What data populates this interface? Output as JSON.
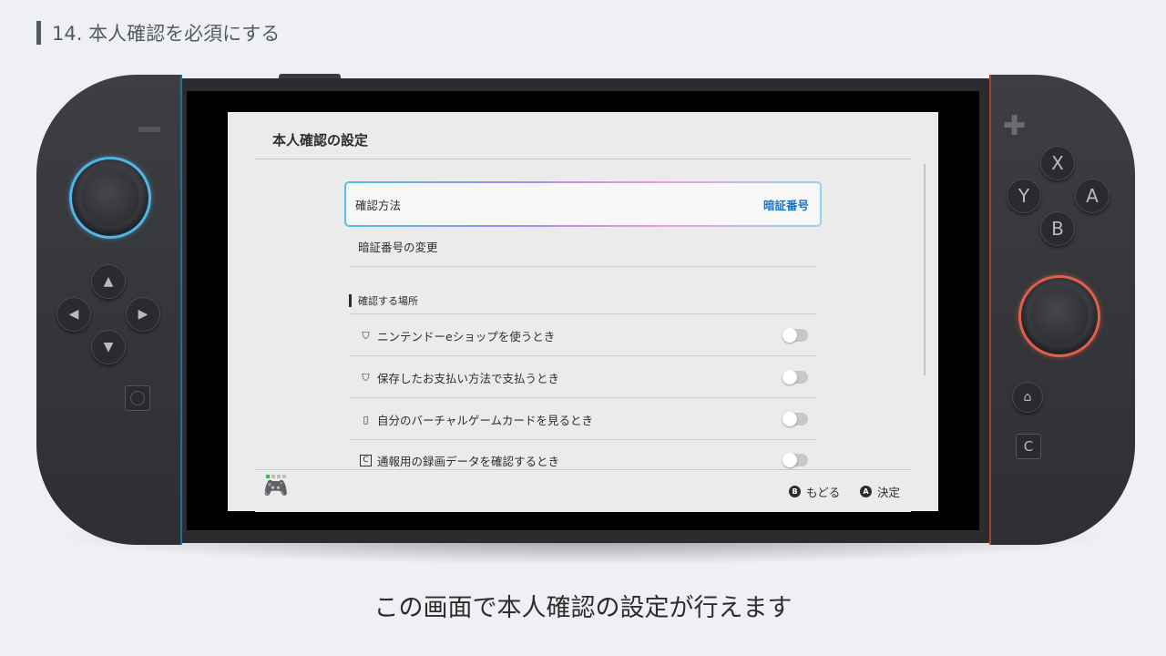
{
  "slide": {
    "title": "14. 本人確認を必須にする",
    "caption": "この画面で本人確認の設定が行えます"
  },
  "console": {
    "right_buttons": {
      "x": "X",
      "y": "Y",
      "a": "A",
      "b": "B",
      "c": "C"
    },
    "colors": {
      "left_accent": "#4fb6e6",
      "right_accent": "#e0604a"
    }
  },
  "screen": {
    "title": "本人確認の設定",
    "method": {
      "label": "確認方法",
      "value": "暗証番号"
    },
    "change_pin": "暗証番号の変更",
    "section_title": "確認する場所",
    "items": [
      {
        "label": "ニンテンドーeショップを使うとき",
        "icon": "shopping-bag-icon",
        "enabled": false
      },
      {
        "label": "保存したお支払い方法で支払うとき",
        "icon": "shopping-bag-icon",
        "enabled": false
      },
      {
        "label": "自分のバーチャルゲームカードを見るとき",
        "icon": "game-card-icon",
        "enabled": false
      },
      {
        "label": "通報用の録画データを確認するとき",
        "icon": "c-box-icon",
        "enabled": false
      }
    ],
    "footer": {
      "back": {
        "button": "B",
        "label": "もどる"
      },
      "confirm": {
        "button": "A",
        "label": "決定"
      }
    },
    "colors": {
      "accent_value": "#1a73c6",
      "controller_dot_active": "#27c24a"
    }
  }
}
